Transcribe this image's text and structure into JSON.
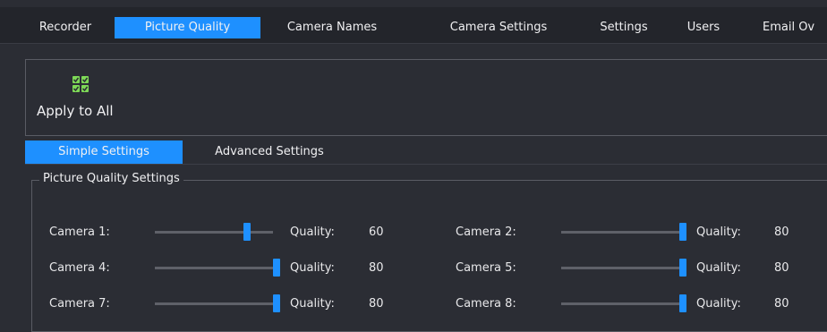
{
  "main_tabs": [
    {
      "label": "Recorder",
      "active": false
    },
    {
      "label": "Picture Quality",
      "active": true
    },
    {
      "label": "Camera Names",
      "active": false
    },
    {
      "label": "Camera Settings",
      "active": false
    },
    {
      "label": "Settings",
      "active": false
    },
    {
      "label": "Users",
      "active": false
    },
    {
      "label": "Email Ov",
      "active": false
    }
  ],
  "toolbar": {
    "apply_label": "Apply to All",
    "apply_icon": "check-grid-icon"
  },
  "sub_tabs": [
    {
      "label": "Simple Settings",
      "active": true
    },
    {
      "label": "Advanced Settings",
      "active": false
    }
  ],
  "group": {
    "title": "Picture Quality Settings",
    "quality_label": "Quality:",
    "slider_max": 80,
    "cameras": [
      {
        "label": "Camera 1:",
        "quality": "60",
        "level": 60
      },
      {
        "label": "Camera 2:",
        "quality": "80",
        "level": 80
      },
      {
        "label": "Camera 4:",
        "quality": "80",
        "level": 80
      },
      {
        "label": "Camera 5:",
        "quality": "80",
        "level": 80
      },
      {
        "label": "Camera 7:",
        "quality": "80",
        "level": 80
      },
      {
        "label": "Camera 8:",
        "quality": "80",
        "level": 80
      }
    ]
  },
  "colors": {
    "accent": "#1e90ff",
    "background": "#2b2d34",
    "tabbar": "#23252b",
    "icon_green": "#7ed957"
  }
}
